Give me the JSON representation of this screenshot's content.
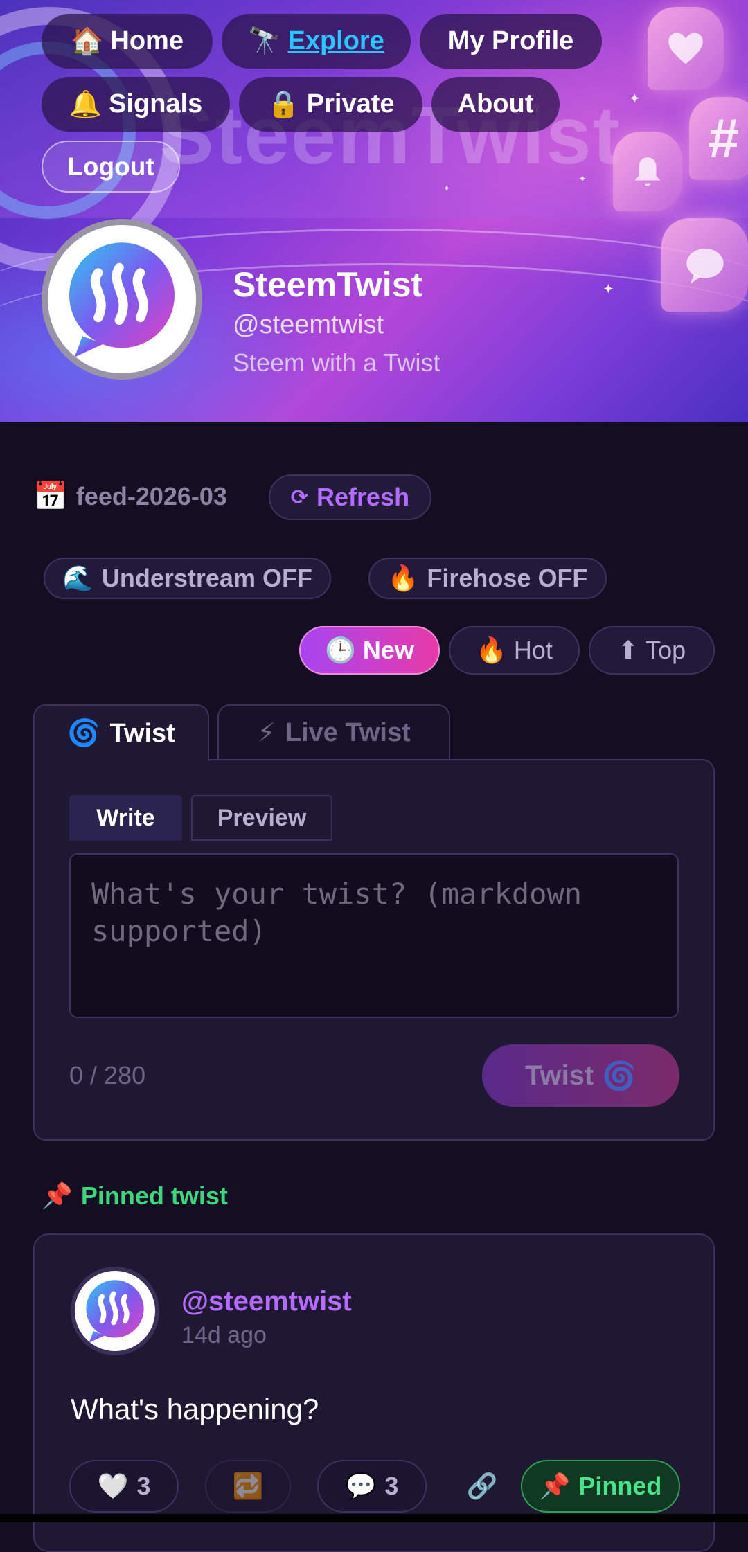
{
  "nav": {
    "home": {
      "emoji": "🏠",
      "label": "Home"
    },
    "explore": {
      "emoji": "🔭",
      "label": "Explore"
    },
    "profile": {
      "label": "My Profile"
    },
    "signals": {
      "emoji": "🔔",
      "label": "Signals"
    },
    "private": {
      "emoji": "🔒",
      "label": "Private"
    },
    "about": {
      "label": "About"
    },
    "logout": {
      "label": "Logout"
    }
  },
  "banner": {
    "wordmark": "SteemTwist"
  },
  "profile": {
    "name": "SteemTwist",
    "handle": "@steemtwist",
    "tagline": "Steem with a Twist"
  },
  "feed": {
    "emoji": "📅",
    "label": "feed-2026-03",
    "refresh_icon": "⟳",
    "refresh_label": "Refresh",
    "understream": {
      "emoji": "🌊",
      "label": "Understream OFF"
    },
    "firehose": {
      "emoji": "🔥",
      "label": "Firehose OFF"
    }
  },
  "sort": {
    "new": {
      "emoji": "🕒",
      "label": "New"
    },
    "hot": {
      "emoji": "🔥",
      "label": "Hot"
    },
    "top": {
      "emoji": "⬆",
      "label": "Top"
    }
  },
  "composer": {
    "tab_twist": {
      "emoji": "🌀",
      "label": "Twist"
    },
    "tab_live": {
      "emoji": "⚡",
      "label": "Live Twist"
    },
    "write_label": "Write",
    "preview_label": "Preview",
    "placeholder": "What's your twist? (markdown supported)",
    "char_count": "0 / 280",
    "submit_label": "Twist",
    "submit_emoji": "🌀"
  },
  "pinned": {
    "section_emoji": "📌",
    "section_label": "Pinned twist",
    "author": "@steemtwist",
    "time": "14d ago",
    "body": "What's happening?",
    "likes": {
      "emoji": "🤍",
      "count": "3"
    },
    "retwist": {
      "emoji": "🔁"
    },
    "comments": {
      "emoji": "💬",
      "count": "3"
    },
    "link": {
      "emoji": "🔗"
    },
    "pinned_badge": {
      "emoji": "📌",
      "label": "Pinned"
    }
  },
  "colors": {
    "accent_purple": "#b66bff",
    "accent_pink": "#e83aa8",
    "link_blue": "#29c6ff",
    "pinned_green": "#3ed67d",
    "page_bg": "#140e22"
  }
}
